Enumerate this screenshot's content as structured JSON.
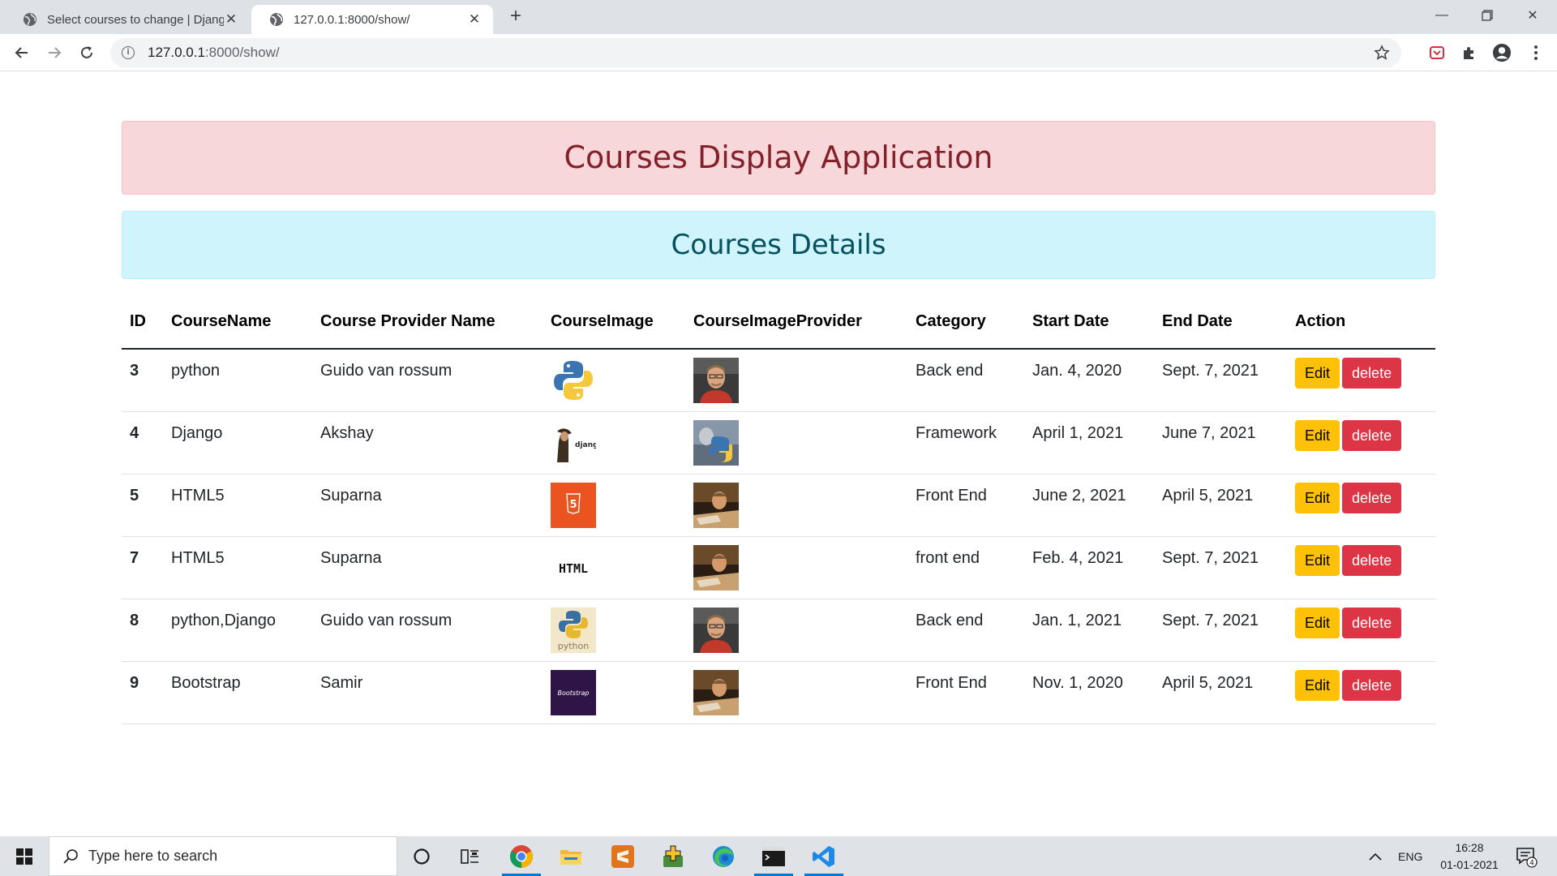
{
  "browser": {
    "tabs": [
      {
        "title": "Select courses to change | Django site admin",
        "active": false
      },
      {
        "title": "127.0.0.1:8000/show/",
        "active": true
      }
    ],
    "url_host": "127.0.0.1",
    "url_rest": ":8000/show/"
  },
  "page": {
    "title": "Courses Display Application",
    "subtitle": "Courses Details",
    "headers": [
      "ID",
      "CourseName",
      "Course Provider Name",
      "CourseImage",
      "CourseImageProvider",
      "Category",
      "Start Date",
      "End Date",
      "Action"
    ],
    "rows": [
      {
        "id": "3",
        "name": "python",
        "provider": "Guido van rossum",
        "course_image": "python-logo-image",
        "provider_image": "person-photo-image",
        "category": "Back end",
        "start": "Jan. 4, 2020",
        "end": "Sept. 7, 2021"
      },
      {
        "id": "4",
        "name": "Django",
        "provider": "Akshay",
        "course_image": "django-image",
        "provider_image": "python-laptop-image",
        "category": "Framework",
        "start": "April 1, 2021",
        "end": "June 7, 2021"
      },
      {
        "id": "5",
        "name": "HTML5",
        "provider": "Suparna",
        "course_image": "html5-logo-image",
        "provider_image": "person-laptop-image",
        "category": "Front End",
        "start": "June 2, 2021",
        "end": "April 5, 2021"
      },
      {
        "id": "7",
        "name": "HTML5",
        "provider": "Suparna",
        "course_image": "html-text-image",
        "provider_image": "person-laptop-image",
        "category": "front end",
        "start": "Feb. 4, 2021",
        "end": "Sept. 7, 2021"
      },
      {
        "id": "8",
        "name": "python,Django",
        "provider": "Guido van rossum",
        "course_image": "python-text-logo-image",
        "provider_image": "person-photo-image",
        "category": "Back end",
        "start": "Jan. 1, 2021",
        "end": "Sept. 7, 2021"
      },
      {
        "id": "9",
        "name": "Bootstrap",
        "provider": "Samir",
        "course_image": "bootstrap-image",
        "provider_image": "person-laptop-image",
        "category": "Front End",
        "start": "Nov. 1, 2020",
        "end": "April 5, 2021"
      }
    ],
    "edit_label": "Edit",
    "delete_label": "delete",
    "image_labels": {
      "django": "django",
      "html": "HTML",
      "python": "python",
      "bootstrap": "Bootstrap",
      "html5": "5"
    }
  },
  "taskbar": {
    "search_placeholder": "Type here to search",
    "language": "ENG",
    "time": "16:28",
    "date": "01-01-2021",
    "notification_count": "4",
    "apps": [
      "cortana-icon",
      "task-view-icon",
      "chrome-icon",
      "file-explorer-icon",
      "sublime-text-icon",
      "app-icon",
      "edge-icon",
      "terminal-icon",
      "vscode-icon"
    ]
  },
  "colors": {
    "alert_danger_bg": "#f8d7da",
    "alert_danger_text": "#842029",
    "alert_info_bg": "#cff4fc",
    "alert_info_text": "#055160",
    "edit_button": "#ffc107",
    "delete_button": "#dc3545"
  }
}
